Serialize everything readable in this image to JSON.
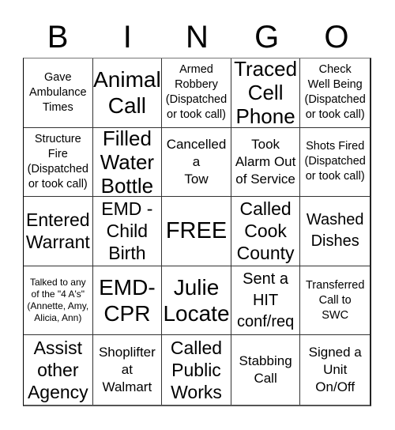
{
  "header": {
    "letters": [
      "B",
      "I",
      "N",
      "G",
      "O"
    ]
  },
  "board": {
    "rows": [
      [
        {
          "text": "Gave\nAmbulance\nTimes",
          "size": "s-sm"
        },
        {
          "text": "Animal\nCall",
          "size": "s-big"
        },
        {
          "text": "Armed\nRobbery\n(Dispatched\nor took call)",
          "size": "s-sm"
        },
        {
          "text": "Traced\nCell\nPhone",
          "size": "s-xxl"
        },
        {
          "text": "Check\nWell Being\n(Dispatched\nor took call)",
          "size": "s-sm"
        }
      ],
      [
        {
          "text": "Structure\nFire\n(Dispatched\nor took call)",
          "size": "s-sm"
        },
        {
          "text": "Filled\nWater\nBottle",
          "size": "s-xxl"
        },
        {
          "text": "Cancelled\na\nTow",
          "size": "s-md"
        },
        {
          "text": "Took\nAlarm Out\nof Service",
          "size": "s-md"
        },
        {
          "text": "Shots Fired\n(Dispatched\nor took call)",
          "size": "s-sm"
        }
      ],
      [
        {
          "text": "Entered\nWarrant",
          "size": "s-xl"
        },
        {
          "text": "EMD -\nChild\nBirth",
          "size": "s-xl"
        },
        {
          "text": "FREE",
          "size": "s-free"
        },
        {
          "text": "Called\nCook\nCounty",
          "size": "s-xl"
        },
        {
          "text": "Washed\nDishes",
          "size": "s-lg"
        }
      ],
      [
        {
          "text": "Talked to any\nof the \"4 A's\"\n(Annette, Amy,\nAlicia, Ann)",
          "size": "s-xs"
        },
        {
          "text": "EMD-\nCPR",
          "size": "s-big"
        },
        {
          "text": "Julie\nLocate",
          "size": "s-big"
        },
        {
          "text": "Sent a\nHIT\nconf/req",
          "size": "s-lg"
        },
        {
          "text": "Transferred\nCall to\nSWC",
          "size": "s-sm"
        }
      ],
      [
        {
          "text": "Assist\nother\nAgency",
          "size": "s-xl"
        },
        {
          "text": "Shoplifter\nat\nWalmart",
          "size": "s-md"
        },
        {
          "text": "Called\nPublic\nWorks",
          "size": "s-xl"
        },
        {
          "text": "Stabbing\nCall",
          "size": "s-md"
        },
        {
          "text": "Signed a\nUnit\nOn/Off",
          "size": "s-md"
        }
      ]
    ]
  }
}
